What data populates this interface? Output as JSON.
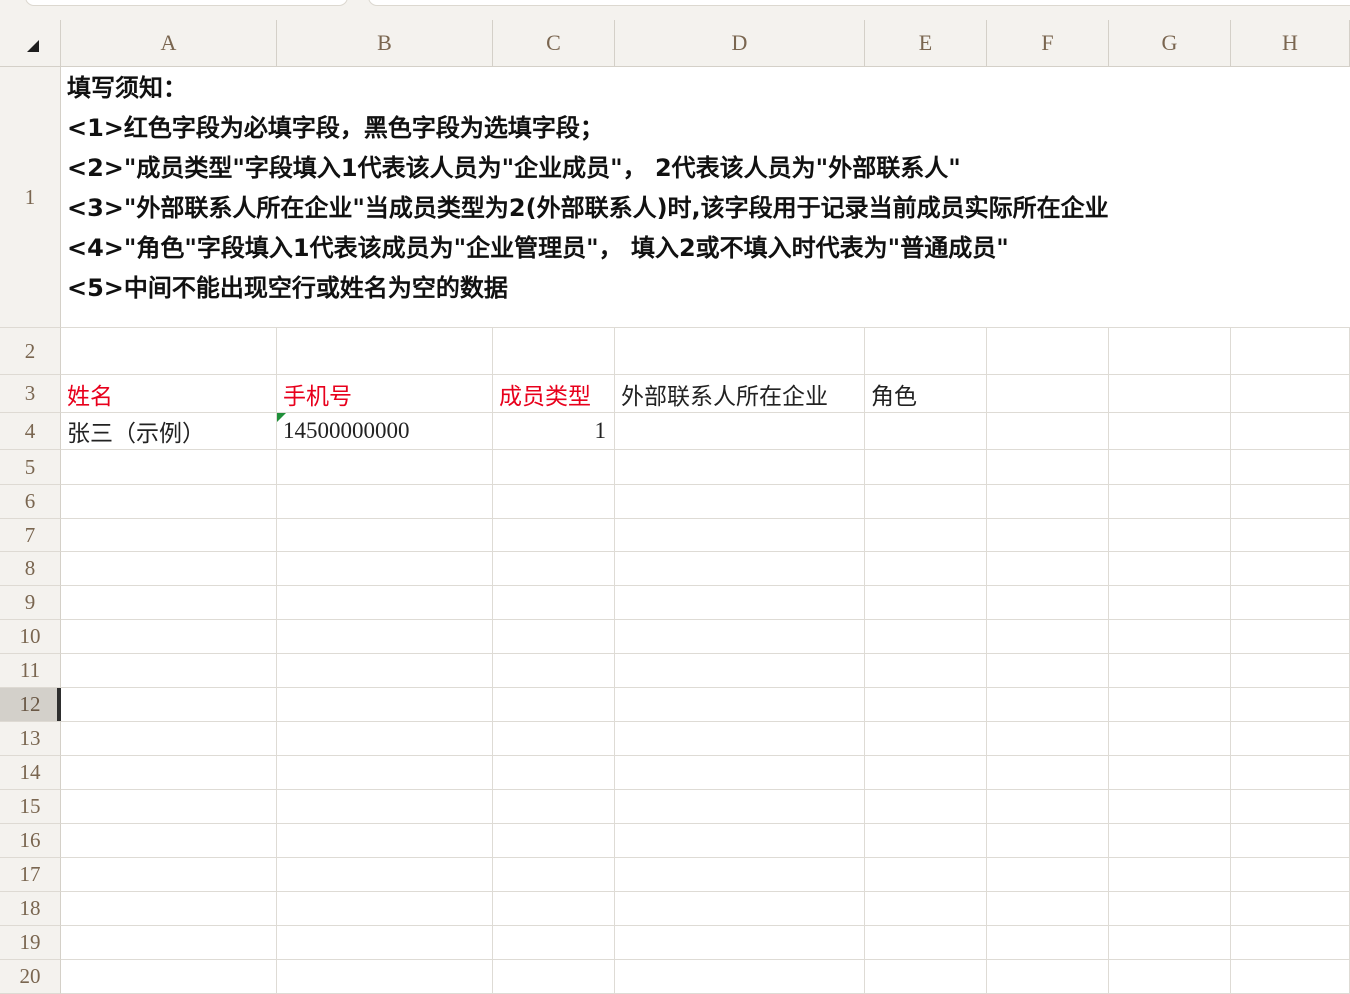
{
  "sheet": {
    "corner_icon": "select-all-icon",
    "columns": [
      "A",
      "B",
      "C",
      "D",
      "E",
      "F",
      "G",
      "H"
    ],
    "rows": [
      "1",
      "2",
      "3",
      "4",
      "5",
      "6",
      "7",
      "8",
      "9",
      "10",
      "11",
      "12",
      "13",
      "14",
      "15",
      "16",
      "17",
      "18",
      "19",
      "20"
    ],
    "selected_row": 12
  },
  "notice": {
    "title": "填写须知：",
    "lines": [
      "<1>红色字段为必填字段，黑色字段为选填字段；",
      "<2>\"成员类型\"字段填入1代表该人员为\"企业成员\"， 2代表该人员为\"外部联系人\"",
      "<3>\"外部联系人所在企业\"当成员类型为2(外部联系人)时,该字段用于记录当前成员实际所在企业",
      "<4>\"角色\"字段填入1代表该成员为\"企业管理员\"， 填入2或不填入时代表为\"普通成员\"",
      "<5>中间不能出现空行或姓名为空的数据"
    ]
  },
  "cells": {
    "A3": {
      "value": "姓名",
      "color": "#e8001c"
    },
    "B3": {
      "value": "手机号",
      "color": "#e8001c"
    },
    "C3": {
      "value": "成员类型",
      "color": "#e8001c"
    },
    "D3": {
      "value": "外部联系人所在企业",
      "color": "#222222"
    },
    "E3": {
      "value": "角色",
      "color": "#222222"
    },
    "A4": {
      "value": "张三（示例）",
      "color": "#222222"
    },
    "B4": {
      "value": "14500000000",
      "color": "#222222",
      "stored_as_text_flag": true
    },
    "C4": {
      "value": 1,
      "color": "#222222"
    }
  },
  "colors": {
    "required_field": "#e8001c",
    "optional_field": "#222222",
    "text_flag": "#1f8f3a",
    "header_text": "#7a6650",
    "selected_row_marker": "#2e2e2e"
  }
}
